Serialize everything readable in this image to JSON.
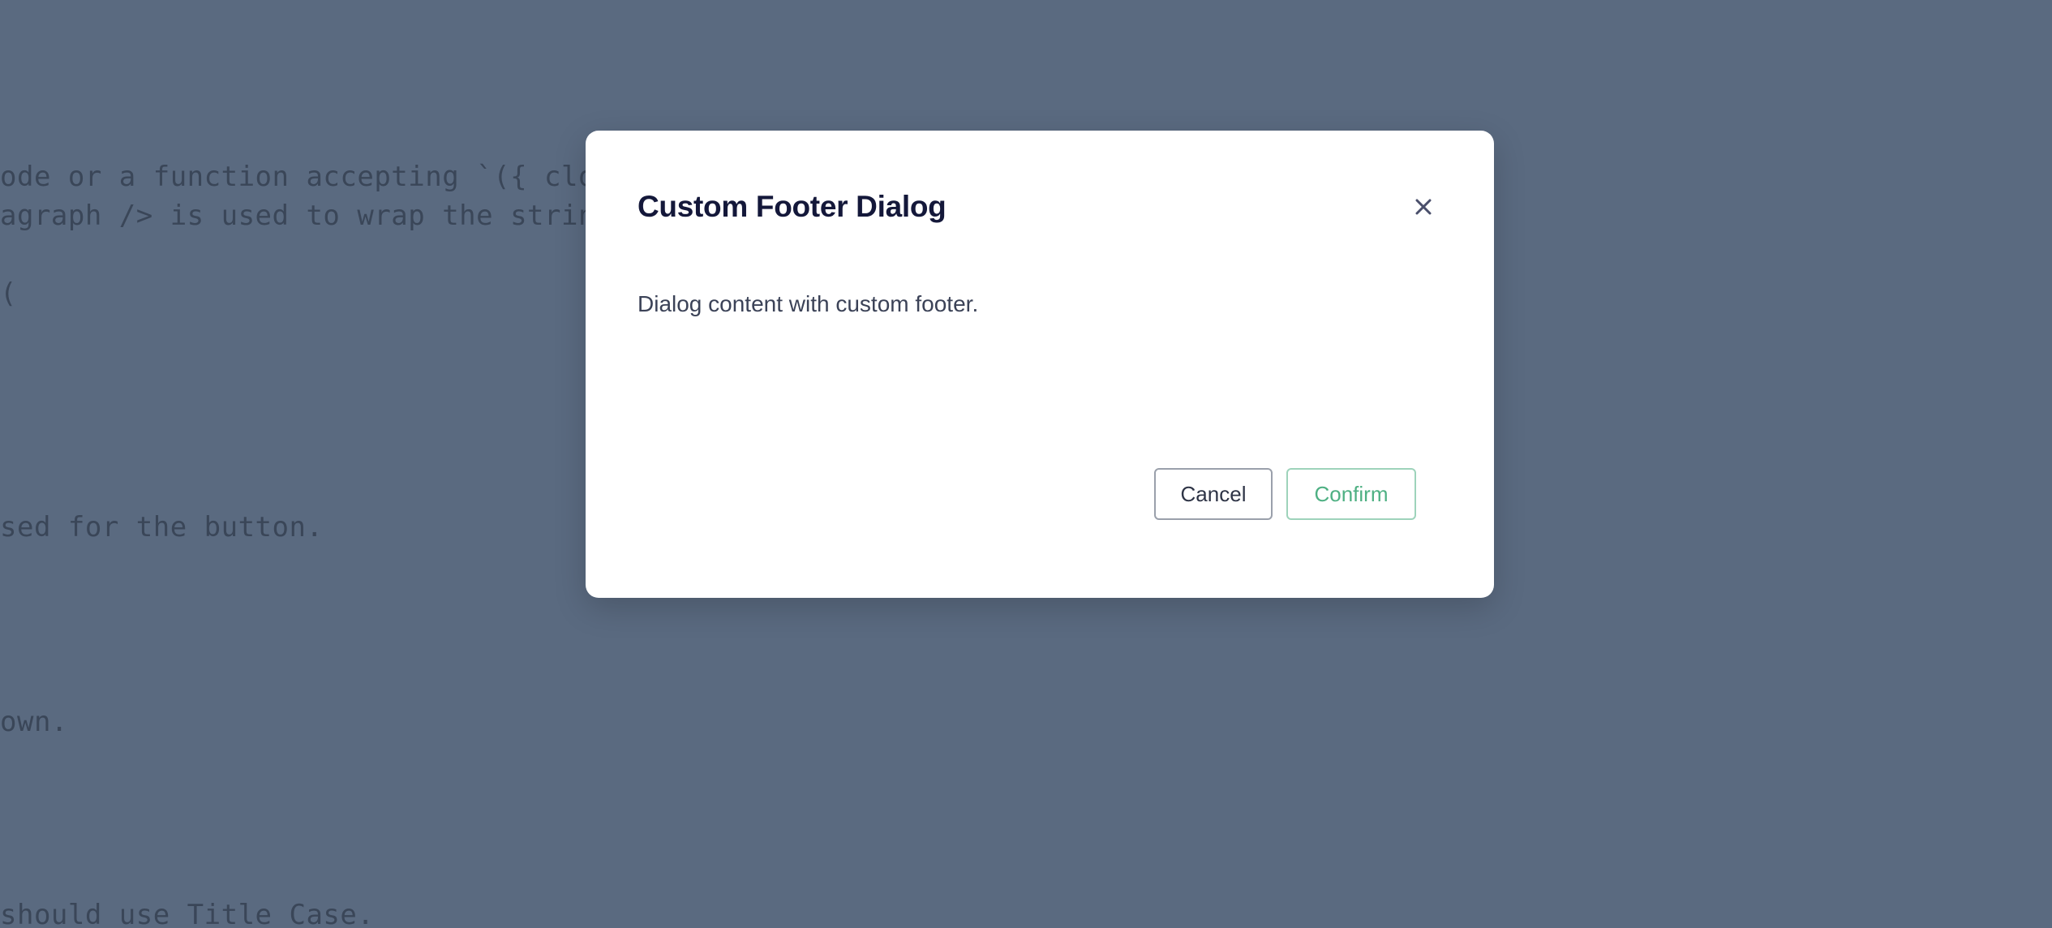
{
  "background": {
    "lines": [
      "ode or a function accepting `({ close",
      "agraph /> is used to wrap the string.",
      "(",
      "sed for the button.",
      "own.",
      " should use Title Case."
    ]
  },
  "dialog": {
    "title": "Custom Footer Dialog",
    "close_icon": "close-icon",
    "body_text": "Dialog content with custom footer.",
    "footer": {
      "cancel_label": "Cancel",
      "confirm_label": "Confirm"
    }
  },
  "colors": {
    "backdrop": "#5a6a80",
    "title": "#14183a",
    "confirm_accent": "#4eb083"
  }
}
